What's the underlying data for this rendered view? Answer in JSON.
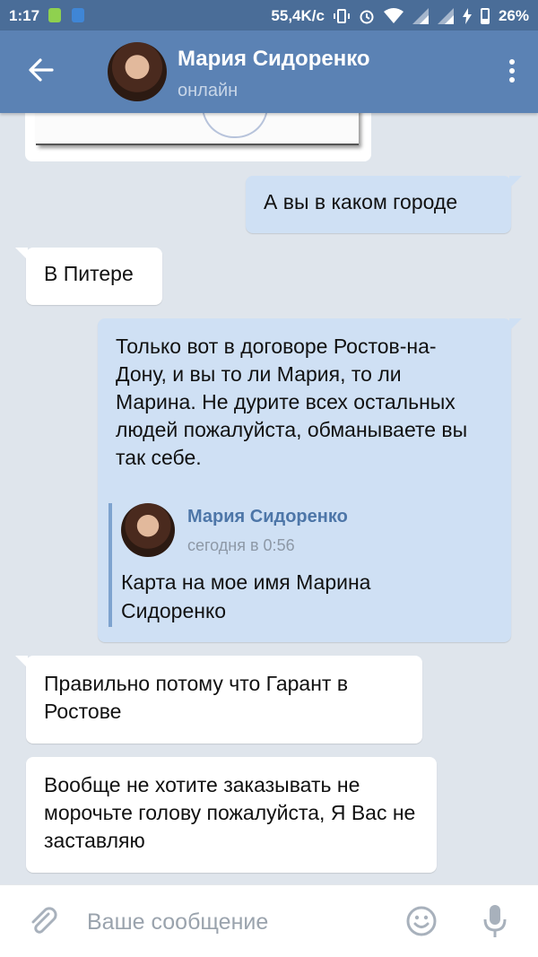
{
  "statusbar": {
    "time": "1:17",
    "net_speed": "55,4K/c",
    "battery": "26%"
  },
  "chat": {
    "name": "Мария Сидоренко",
    "status": "онлайн"
  },
  "messages": [
    {
      "dir": "out",
      "text": "А вы в каком городе"
    },
    {
      "dir": "in",
      "text": "В Питере"
    },
    {
      "dir": "out",
      "text": "Только вот в договоре Ростов-на-Дону, и вы то ли Мария, то ли Марина. Не дурите всех остальных людей пожалуйста, обманываете вы так себе.",
      "reply": {
        "author": "Мария Сидоренко",
        "time": "сегодня в 0:56",
        "text": "Карта на мое имя Марина Сидоренко"
      }
    },
    {
      "dir": "in",
      "text": "Правильно потому что Гарант в Ростове"
    },
    {
      "dir": "in",
      "text": "Вообще не хотите заказывать не морочьте голову пожалуйста, Я Вас не заставляю"
    }
  ],
  "composer": {
    "placeholder": "Ваше сообщение"
  },
  "colors": {
    "header": "#5b82b4",
    "outgoing_bubble": "#cfe0f4",
    "incoming_bubble": "#ffffff",
    "background": "#dfe5ec"
  }
}
